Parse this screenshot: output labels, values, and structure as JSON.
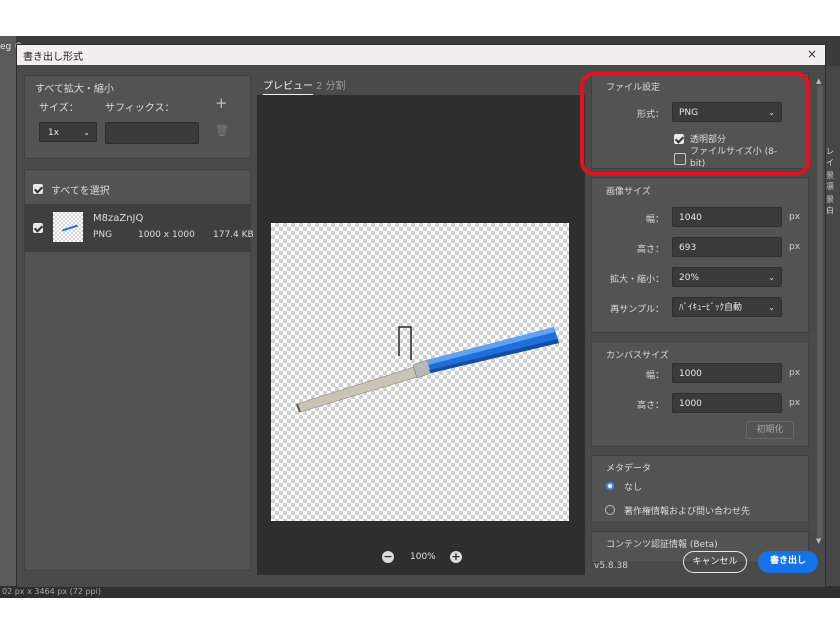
{
  "background": {
    "left_tab_text": "eg ©",
    "bottom_status": "02 px x 3464 px (72 ppi)",
    "right_items": [
      "レイ",
      "景凛",
      "景白"
    ]
  },
  "dialog": {
    "title": "書き出し形式",
    "close_glyph": "×"
  },
  "scale_all": {
    "heading": "すべて拡大・縮小",
    "size_label": "サイズ：",
    "suffix_label": "サフィックス：",
    "add_glyph": "+",
    "size_value": "1x",
    "suffix_value": "",
    "trash_glyph": "🗑"
  },
  "asset_list": {
    "select_all_label": "すべてを選択",
    "items": [
      {
        "name": "M8zaZnJQ",
        "format": "PNG",
        "dimensions": "1000 x 1000",
        "filesize": "177.4 KB"
      }
    ]
  },
  "preview": {
    "tabs": [
      "プレビュー",
      "2 分割"
    ],
    "active_tab": 0,
    "zoom_out_glyph": "−",
    "zoom_level": "100%",
    "zoom_in_glyph": "+"
  },
  "file_settings": {
    "heading": "ファイル設定",
    "format_label": "形式：",
    "format_value": "PNG",
    "transparency_label": "透明部分",
    "transparency_checked": true,
    "smaller_file_label_line1": "ファイルサイズ小 (8-",
    "smaller_file_label_line2": "bit)",
    "smaller_file_checked": false
  },
  "image_size": {
    "heading": "画像サイズ",
    "width_label": "幅：",
    "width_value": "1040",
    "height_label": "高さ：",
    "height_value": "693",
    "scale_label": "拡大・縮小：",
    "scale_value": "20%",
    "resample_label": "再サンプル：",
    "resample_value": "ﾊﾞｲｷｭｰﾋﾞｯｸ自動",
    "unit": "px"
  },
  "canvas_size": {
    "heading": "カンバスサイズ",
    "width_label": "幅：",
    "width_value": "1000",
    "height_label": "高さ：",
    "height_value": "1000",
    "reset_label": "初期化",
    "unit": "px"
  },
  "metadata": {
    "heading": "メタデータ",
    "options": [
      "なし",
      "著作権情報および問い合わせ先"
    ],
    "selected": 0
  },
  "content_credentials": {
    "heading": "コンテンツ認証情報 (Beta)"
  },
  "footer": {
    "version": "v5.8.38",
    "cancel_label": "キャンセル",
    "export_label": "書き出し"
  },
  "colors": {
    "accent": "#1473e6",
    "highlight": "#e5121d",
    "pen_blue": "#1e6fd9"
  }
}
